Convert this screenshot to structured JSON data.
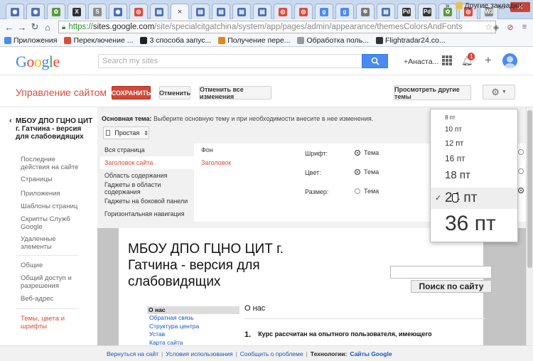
{
  "browser": {
    "tabs": [
      {
        "icon": "site-globe-icon",
        "color": "#4a6fb5",
        "glyph": "◉"
      },
      {
        "icon": "site-globe-icon",
        "color": "#4a6fb5",
        "glyph": "◉"
      },
      {
        "icon": "leaf-icon",
        "color": "#5a9a3a",
        "glyph": "✿"
      },
      {
        "icon": "x-icon",
        "color": "#333333",
        "glyph": "X"
      },
      {
        "icon": "s-icon",
        "color": "#8a8a8a",
        "glyph": "S"
      },
      {
        "icon": "site-globe-icon",
        "color": "#4a6fb5",
        "glyph": "◉"
      },
      {
        "icon": "chrome-icon",
        "color": "#dd4b39",
        "glyph": "◎"
      },
      {
        "icon": "doc-icon",
        "color": "#4a6fb5",
        "glyph": "▤"
      },
      {
        "icon": "close-icon",
        "color": "#444444",
        "glyph": "×",
        "active": true
      },
      {
        "icon": "doc-icon",
        "color": "#4a6fb5",
        "glyph": "▤"
      },
      {
        "icon": "doc-icon",
        "color": "#4a6fb5",
        "glyph": "▤"
      },
      {
        "icon": "doc-icon",
        "color": "#4a6fb5",
        "glyph": "▤"
      },
      {
        "icon": "doc-icon",
        "color": "#4a6fb5",
        "glyph": "▤"
      },
      {
        "icon": "chrome-icon",
        "color": "#dd4b39",
        "glyph": "◎"
      },
      {
        "icon": "chrome-icon",
        "color": "#dd4b39",
        "glyph": "◎"
      },
      {
        "icon": "google-icon",
        "color": "#4a8af4",
        "glyph": "g"
      },
      {
        "icon": "google-icon",
        "color": "#4a8af4",
        "glyph": "g"
      },
      {
        "icon": "gear-icon",
        "color": "#777777",
        "glyph": "✲"
      },
      {
        "icon": "doc-icon",
        "color": "#4a6fb5",
        "glyph": "▤"
      },
      {
        "icon": "pdf-icon",
        "color": "#333333",
        "glyph": "Pd"
      },
      {
        "icon": "pdf-icon",
        "color": "#333333",
        "glyph": "Pd"
      },
      {
        "icon": "leaf-icon",
        "color": "#5a9a3a",
        "glyph": "✿"
      },
      {
        "icon": "chrome-icon",
        "color": "#dd4b39",
        "glyph": "◎"
      },
      {
        "icon": "w3-icon",
        "color": "#888888",
        "glyph": "W3"
      }
    ],
    "url_https": "https://",
    "url_host": "sites.google.com",
    "url_path": "/site/specialcitgatchina/system/app/pages/admin/appearance/themesColorsAndFonts",
    "bookmarks": [
      {
        "label": "Приложения",
        "color": "#4a8af4"
      },
      {
        "label": "Переключение ...",
        "color": "#dd4b39"
      },
      {
        "label": "3 способа запус...",
        "color": "#222222"
      },
      {
        "label": "Получение пере...",
        "color": "#dd8b1a"
      },
      {
        "label": "Обработка поль...",
        "color": "#999999"
      },
      {
        "label": "Flightradar24.co...",
        "color": "#333333"
      }
    ],
    "bookmarks_more": "»",
    "other_bookmarks": "Другие закладки"
  },
  "google_bar": {
    "logo": "Google",
    "logo_colors": [
      "#4285f4",
      "#ea4335",
      "#fbbc05",
      "#4285f4",
      "#34a853",
      "#ea4335"
    ],
    "search_placeholder": "Search my sites",
    "user": "+Анаста...",
    "notification_count": "1"
  },
  "page_header": {
    "title": "Управление сайтом",
    "save": "СОХРАНИТЬ",
    "cancel": "Отменить",
    "cancel_all": "Отменить все изменения",
    "other_themes": "Просмотреть другие темы"
  },
  "sidebar": {
    "site_name": "МБОУ ДПО ГЦНО ЦИТ г. Гатчина - версия для слабовидящих",
    "group1": [
      "Последние действия на сайте",
      "Страницы",
      "Приложения",
      "Шаблоны страниц",
      "Скрипты Служб Google",
      "Удаленные элементы"
    ],
    "group2": [
      "Общие",
      "Общий доступ и разрешения",
      "Веб-адрес"
    ],
    "group3": [
      "Темы, цвета и шрифты"
    ]
  },
  "editor": {
    "intro_label": "Основная тема:",
    "intro_text": " Выберите основную тему и при необходимости внесите в нее изменения.",
    "theme": "Простая",
    "areas": [
      "Вся страница",
      "Заголовок сайта",
      "Область содержания",
      "Гаджеты в области содержания",
      "Гаджеты на боковой панели",
      "Горизонтальная навигация"
    ],
    "selected_area_index": 1,
    "elements": [
      "Фон",
      "Заголовок"
    ],
    "props": {
      "font": "Шрифт:",
      "color": "Цвет:",
      "size": "Размер:",
      "theme_option": "Тема"
    }
  },
  "font_menu": {
    "items": [
      {
        "label": "8 пт",
        "size": 8
      },
      {
        "label": "10 пт",
        "size": 10
      },
      {
        "label": "12 пт",
        "size": 11
      },
      {
        "label": "16 пт",
        "size": 12
      },
      {
        "label": "18 пт",
        "size": 15
      },
      {
        "label": "24 пт",
        "size": 19
      },
      {
        "label": "36 пт",
        "size": 30
      }
    ],
    "selected_index": 5
  },
  "preview": {
    "site_title": "МБОУ ДПО ГЦНО ЦИТ г. Гатчина - версия для слабовидящих",
    "search_button": "Поиск по сайту",
    "nav_head": "О нас",
    "nav_items": [
      "Обратная связь",
      "Структура центра",
      "Устав",
      "Карта сайта"
    ],
    "content_heading": "О нас",
    "list_num": "1.",
    "list_text": "Курс рассчитан на опытного пользователя, имеющего"
  },
  "footer": {
    "links": [
      "Вернуться на сайт",
      "Условия использования",
      "Сообщить о проблеме"
    ],
    "sep": "|",
    "tech_label": "Технологии:",
    "tech_link": "Сайты Google"
  }
}
